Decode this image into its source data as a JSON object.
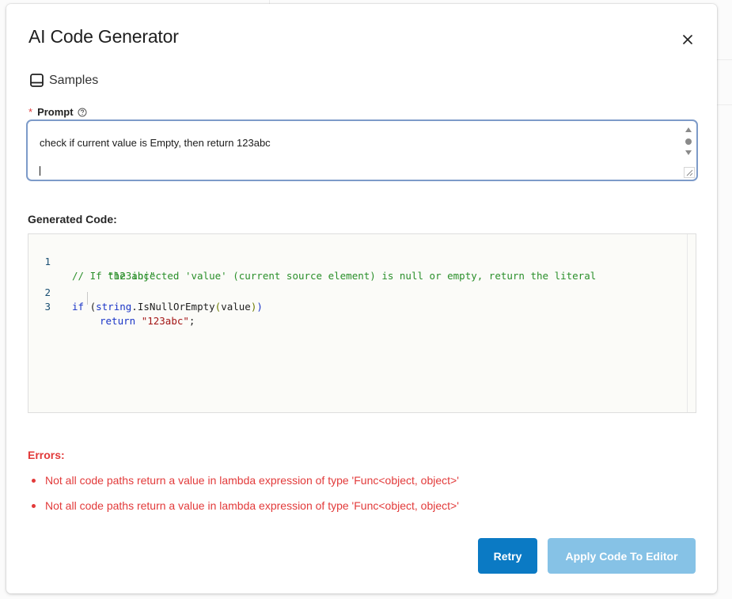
{
  "dialog": {
    "title": "AI Code Generator",
    "close_icon": "close-icon",
    "samples_label": "Samples",
    "samples_icon": "book-icon"
  },
  "prompt": {
    "required_mark": "*",
    "label": "Prompt",
    "help_icon": "question-circle-icon",
    "value": "check if current value is Empty, then return 123abc"
  },
  "generated_code": {
    "label": "Generated Code:",
    "lines": [
      {
        "number": "1",
        "text": "// If the injected 'value' (current source element) is null or empty, return the literal",
        "continuation": "\"123abc\""
      },
      {
        "number": "2",
        "kw_if": "if",
        "paren_open": " (",
        "obj": "string",
        "dot": ".",
        "method": "IsNullOrEmpty",
        "inner_open": "(",
        "arg": "value",
        "inner_close": ")",
        "paren_close": ")"
      },
      {
        "number": "3",
        "kw_return": "return",
        "literal": "\"123abc\"",
        "end": ";"
      }
    ]
  },
  "errors": {
    "title": "Errors:",
    "items": [
      "Not all code paths return a value in lambda expression of type 'Func<object, object>'",
      "Not all code paths return a value in lambda expression of type 'Func<object, object>'"
    ]
  },
  "actions": {
    "retry_label": "Retry",
    "apply_label": "Apply Code To Editor"
  },
  "colors": {
    "primary": "#0b7ac4",
    "primary_disabled": "#86c2e6",
    "error": "#e23a3a",
    "comment": "#2a8f2a",
    "keyword": "#1a35c7",
    "string": "#a31515",
    "focus_border": "#7d9bc9"
  }
}
